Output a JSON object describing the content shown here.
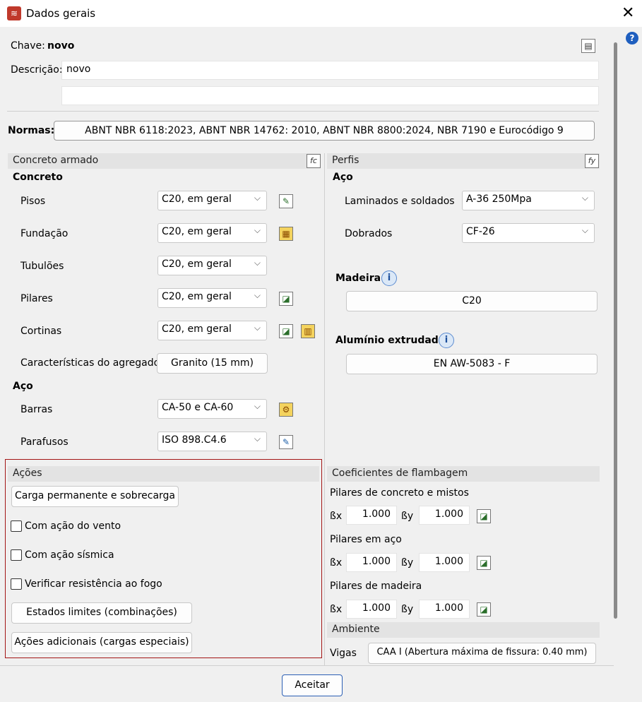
{
  "window": {
    "title": "Dados gerais",
    "close": "✕",
    "help": "?"
  },
  "chave": {
    "label": "Chave:",
    "value": "novo"
  },
  "descricao": {
    "label": "Descrição:",
    "line1": "novo",
    "line2": ""
  },
  "normas": {
    "label": "Normas:",
    "value": "ABNT NBR 6118:2023, ABNT NBR 14762: 2010, ABNT NBR 8800:2024, NBR 7190 e Eurocódigo 9"
  },
  "concreto_armado": {
    "header": "Concreto armado",
    "concreto_title": "Concreto",
    "rows": [
      {
        "label": "Pisos",
        "value": "C20, em geral"
      },
      {
        "label": "Fundação",
        "value": "C20, em geral"
      },
      {
        "label": "Tubulões",
        "value": "C20, em geral"
      },
      {
        "label": "Pilares",
        "value": "C20, em geral"
      },
      {
        "label": "Cortinas",
        "value": "C20, em geral"
      }
    ],
    "agregado_label": "Características do agregado",
    "agregado_value": "Granito (15 mm)",
    "aco_title": "Aço",
    "barras_label": "Barras",
    "barras_value": "CA-50 e CA-60",
    "parafusos_label": "Parafusos",
    "parafusos_value": "ISO 898.C4.6"
  },
  "perfis": {
    "header": "Perfis",
    "aco_title": "Aço",
    "laminados_label": "Laminados e soldados",
    "laminados_value": "A-36 250Mpa",
    "dobrados_label": "Dobrados",
    "dobrados_value": "CF-26",
    "madeira_title": "Madeira",
    "madeira_value": "C20",
    "aluminio_title": "Alumínio extrudado",
    "aluminio_value": "EN AW-5083 - F"
  },
  "acoes": {
    "header": "Ações",
    "carga_button": "Carga permanente e sobrecarga",
    "vento": "Com ação do vento",
    "sismica": "Com ação sísmica",
    "fogo": "Verificar resistência ao fogo",
    "estados_button": "Estados limites (combinações)",
    "adicionais_button": "Ações adicionais (cargas especiais)"
  },
  "flambagem": {
    "header": "Coeficientes de flambagem",
    "bx": "ßx",
    "by": "ßy",
    "groups": [
      {
        "title": "Pilares de concreto e mistos",
        "bx": "1.000",
        "by": "1.000"
      },
      {
        "title": "Pilares em aço",
        "bx": "1.000",
        "by": "1.000"
      },
      {
        "title": "Pilares de madeira",
        "bx": "1.000",
        "by": "1.000"
      }
    ]
  },
  "ambiente": {
    "header": "Ambiente",
    "vigas_label": "Vigas",
    "vigas_value": "CAA I (Abertura máxima de fissura: 0.40 mm)"
  },
  "footer": {
    "accept": "Aceitar"
  },
  "icons": {
    "fc": "fc",
    "fy": "fy",
    "info": "i"
  }
}
